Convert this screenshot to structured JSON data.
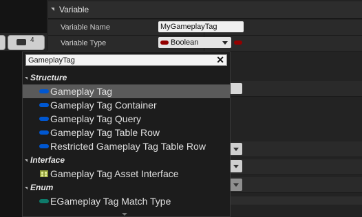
{
  "viewport_toolbar": {
    "count": "4"
  },
  "details": {
    "section_title": "Variable",
    "rows": {
      "name_label": "Variable Name",
      "name_value": "MyGameplayTag",
      "type_label": "Variable Type",
      "type_value": "Boolean"
    }
  },
  "popup": {
    "search": {
      "value": "GameplayTag"
    },
    "categories": {
      "structure": "Structure",
      "interface": "Interface",
      "enum": "Enum"
    },
    "items": [
      {
        "label": "Gameplay Tag",
        "color": "#0057d1"
      },
      {
        "label": "Gameplay Tag Container",
        "color": "#0057d1"
      },
      {
        "label": "Gameplay Tag Query",
        "color": "#0057d1"
      },
      {
        "label": "Gameplay Tag Table Row",
        "color": "#0057d1"
      },
      {
        "label": "Restricted Gameplay Tag Table Row",
        "color": "#0057d1"
      },
      {
        "label": "Gameplay Tag Asset Interface",
        "color": "#c9d47a"
      },
      {
        "label": "EGameplay Tag Match Type",
        "color": "#0e7a6a"
      }
    ]
  },
  "colors": {
    "boolean_pin": "#930000",
    "struct_pin": "#0057d1",
    "enum_pin": "#0e7a6a"
  }
}
